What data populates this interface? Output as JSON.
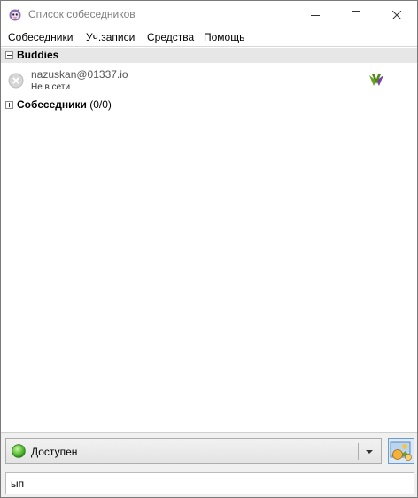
{
  "window": {
    "title": "Список собеседников"
  },
  "menu": {
    "items": [
      {
        "label": "Собеседники",
        "icon": "none"
      },
      {
        "label": "Уч.записи"
      },
      {
        "label": "Средства"
      },
      {
        "label": "Помощь"
      }
    ]
  },
  "buddy_list": {
    "groups": [
      {
        "name": "Buddies",
        "expanded": true,
        "count": "",
        "buddies": [
          {
            "name": "nazuskan@01337.io",
            "status": "Не в сети",
            "status_icon": "offline-x-icon",
            "protocol_icon": "jabber-xmpp-icon"
          }
        ]
      },
      {
        "name": "Собеседники",
        "expanded": false,
        "count": "(0/0)"
      }
    ]
  },
  "status_selector": {
    "selected": "Доступен",
    "icon": "available-green-icon"
  },
  "status_message": {
    "value": "ып"
  },
  "colors": {
    "available": "#3fb33a",
    "group_header_bg": "#e7e7e7",
    "protocol_green": "#6aa121",
    "protocol_purple": "#7a3fa3"
  }
}
